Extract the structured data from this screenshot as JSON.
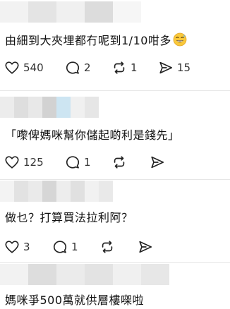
{
  "posts": [
    {
      "text": "由細到大夾埋都冇呢到1/10咁多",
      "has_emoji": true,
      "emoji_icon": "grinning-sweat-emoji",
      "likes": "540",
      "replies": "2",
      "reposts": "1",
      "shares": "15"
    },
    {
      "text": "「嚟俾媽咪幫你儲起啲利是錢先」",
      "likes": "125",
      "replies": "1",
      "reposts": "",
      "shares": ""
    },
    {
      "text": "做乜？打算買法拉利阿？",
      "likes": "3",
      "replies": "1",
      "reposts": "",
      "shares": ""
    },
    {
      "text": "媽咪爭500萬就供層樓㗎啦"
    }
  ],
  "icons": {
    "like": "heart-icon",
    "reply": "reply-bubble-icon",
    "repost": "repost-icon",
    "share": "share-send-icon"
  },
  "colors": {
    "icon": "#222222",
    "blur_light": "#efefef",
    "blur_mid": "#d8d8d8",
    "blur_blue": "#cfe6f3"
  }
}
